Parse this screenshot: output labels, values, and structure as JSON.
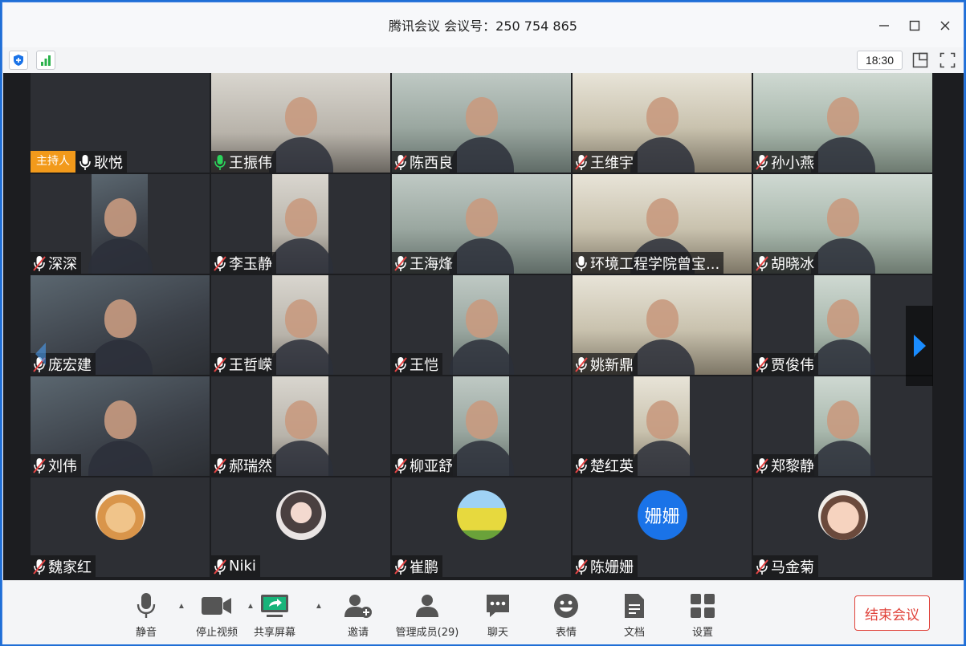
{
  "window": {
    "title": "腾讯会议 会议号：250 754 865"
  },
  "status": {
    "time": "18:30"
  },
  "host_badge": "主持人",
  "participants": [
    {
      "name": "耿悦",
      "mic": "on",
      "host": true,
      "media": "none"
    },
    {
      "name": "王振伟",
      "mic": "active",
      "media": "video"
    },
    {
      "name": "陈西良",
      "mic": "muted",
      "media": "video"
    },
    {
      "name": "王维宇",
      "mic": "muted",
      "media": "video"
    },
    {
      "name": "孙小燕",
      "mic": "muted",
      "media": "video"
    },
    {
      "name": "深深",
      "mic": "muted",
      "media": "video-narrow"
    },
    {
      "name": "李玉静",
      "mic": "muted",
      "media": "video-narrow"
    },
    {
      "name": "王海烽",
      "mic": "muted",
      "media": "video"
    },
    {
      "name": "环境工程学院曾宝...",
      "mic": "on",
      "media": "video"
    },
    {
      "name": "胡晓冰",
      "mic": "muted",
      "media": "video"
    },
    {
      "name": "庞宏建",
      "mic": "muted",
      "media": "video"
    },
    {
      "name": "王哲嵘",
      "mic": "muted",
      "media": "video-narrow"
    },
    {
      "name": "王恺",
      "mic": "muted",
      "media": "video-narrow"
    },
    {
      "name": "姚新鼎",
      "mic": "muted",
      "media": "video"
    },
    {
      "name": "贾俊伟",
      "mic": "muted",
      "media": "video-narrow"
    },
    {
      "name": "刘伟",
      "mic": "muted",
      "media": "video"
    },
    {
      "name": "郝瑞然",
      "mic": "muted",
      "media": "video-narrow"
    },
    {
      "name": "柳亚舒",
      "mic": "muted",
      "media": "video-narrow"
    },
    {
      "name": "楚红英",
      "mic": "muted",
      "media": "video-narrow"
    },
    {
      "name": "郑黎静",
      "mic": "muted",
      "media": "video-narrow"
    },
    {
      "name": "魏家红",
      "mic": "muted",
      "media": "avatar",
      "avatar": "dog"
    },
    {
      "name": "Niki",
      "mic": "muted",
      "media": "avatar",
      "avatar": "girl"
    },
    {
      "name": "崔鹏",
      "mic": "muted",
      "media": "avatar",
      "avatar": "field"
    },
    {
      "name": "陈姗姗",
      "mic": "muted",
      "media": "avatar",
      "avatar": "text",
      "avatar_text": "姗姗"
    },
    {
      "name": "马金菊",
      "mic": "muted",
      "media": "avatar",
      "avatar": "baby"
    }
  ],
  "toolbar": {
    "mute": "静音",
    "stop_video": "停止视频",
    "share_screen": "共享屏幕",
    "invite": "邀请",
    "manage_members": "管理成员(29)",
    "chat": "聊天",
    "emoji": "表情",
    "docs": "文档",
    "settings": "设置",
    "end_meeting": "结束会议"
  },
  "colors": {
    "accent": "#1a73e8",
    "host_badge": "#f29a1b",
    "end": "#e0423a",
    "active_mic": "#2bd45b",
    "muted_mic": "#e64545"
  }
}
